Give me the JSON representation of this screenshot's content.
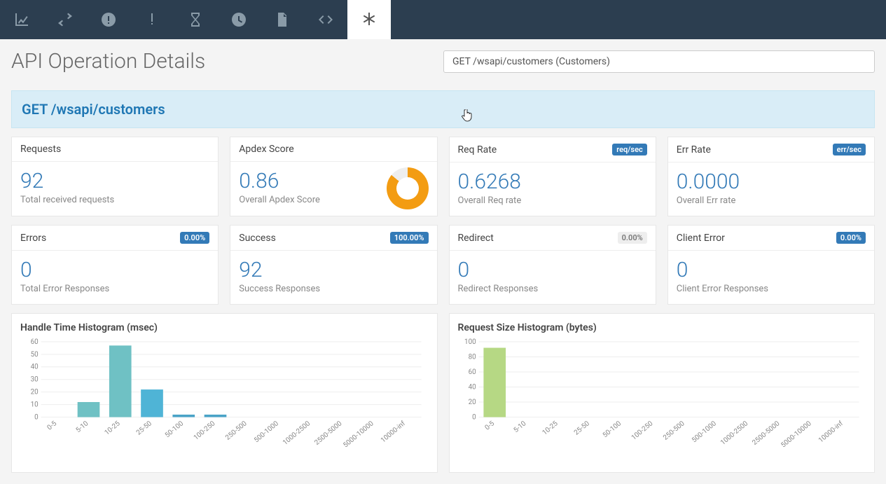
{
  "page_title": "API Operation Details",
  "selector_text": "GET /wsapi/customers (Customers)",
  "banner": "GET /wsapi/customers",
  "kpi_row1": [
    {
      "title": "Requests",
      "value": "92",
      "sub": "Total received requests"
    },
    {
      "title": "Apdex Score",
      "value": "0.86",
      "sub": "Overall Apdex Score",
      "donut": true
    },
    {
      "title": "Req Rate",
      "value": "0.6268",
      "sub": "Overall Req rate",
      "badge": "req/sec",
      "badge_class": ""
    },
    {
      "title": "Err Rate",
      "value": "0.0000",
      "sub": "Overall Err rate",
      "badge": "err/sec",
      "badge_class": ""
    }
  ],
  "kpi_row2": [
    {
      "title": "Errors",
      "value": "0",
      "sub": "Total Error Responses",
      "badge": "0.00%",
      "badge_class": ""
    },
    {
      "title": "Success",
      "value": "92",
      "sub": "Success Responses",
      "badge": "100.00%",
      "badge_class": ""
    },
    {
      "title": "Redirect",
      "value": "0",
      "sub": "Redirect Responses",
      "badge": "0.00%",
      "badge_class": "muted"
    },
    {
      "title": "Client Error",
      "value": "0",
      "sub": "Client Error Responses",
      "badge": "0.00%",
      "badge_class": ""
    }
  ],
  "chart_data": [
    {
      "type": "bar",
      "title": "Handle Time Histogram (msec)",
      "categories": [
        "0-5",
        "5-10",
        "10-25",
        "25-50",
        "50-100",
        "100-250",
        "250-500",
        "500-1000",
        "1000-2500",
        "2500-5000",
        "5000-10000",
        "10000-inf"
      ],
      "values": [
        0,
        12,
        57,
        22,
        2,
        2,
        0,
        0,
        0,
        0,
        0,
        0
      ],
      "ylim": [
        0,
        60
      ],
      "yticks": [
        0,
        10,
        20,
        30,
        40,
        50,
        60
      ],
      "color": "#6fc1c4"
    },
    {
      "type": "bar",
      "title": "Request Size Histogram (bytes)",
      "categories": [
        "0-5",
        "5-10",
        "10-25",
        "25-50",
        "50-100",
        "100-250",
        "250-500",
        "500-1000",
        "1000-2500",
        "2500-5000",
        "5000-10000",
        "10000-inf"
      ],
      "values": [
        92,
        0,
        0,
        0,
        0,
        0,
        0,
        0,
        0,
        0,
        0,
        0
      ],
      "ylim": [
        0,
        100
      ],
      "yticks": [
        0,
        20,
        40,
        60,
        80,
        100
      ],
      "color": "#b6d884"
    }
  ],
  "colors": {
    "brand": "#337ab7",
    "banner_bg": "#d9edf7",
    "topbar": "#2c3e50"
  }
}
